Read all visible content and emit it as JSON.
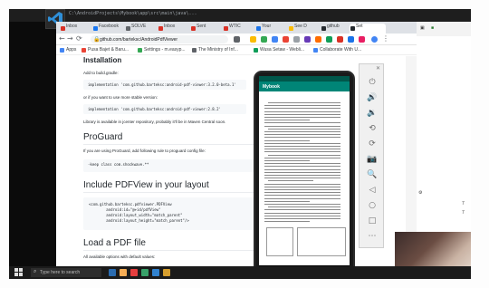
{
  "browser": {
    "tabs": [
      {
        "label": "Inbox",
        "color": "#d93025"
      },
      {
        "label": "Facebook",
        "color": "#1877f2"
      },
      {
        "label": "SOLVE",
        "color": "#5f6368"
      },
      {
        "label": "Inbox",
        "color": "#d93025"
      },
      {
        "label": "Sent",
        "color": "#d93025"
      },
      {
        "label": "WTIC",
        "color": "#d93025"
      },
      {
        "label": "Your",
        "color": "#1a73e8"
      },
      {
        "label": "See D",
        "color": "#fbbc04"
      },
      {
        "label": "github",
        "color": "#24292e"
      },
      {
        "label": "Set",
        "color": "#24292e"
      }
    ],
    "url": "github.com/barteksc/AndroidPdfViewer",
    "bookmarks": [
      {
        "label": "Apps",
        "color": "#4285f4"
      },
      {
        "label": "Pusa Bajet & Baru...",
        "color": "#ea4335"
      },
      {
        "label": "Settings - m.easyp...",
        "color": "#34a853"
      },
      {
        "label": "The Ministry of Inf...",
        "color": "#5f6368"
      },
      {
        "label": "Wusa Setaw - Webli...",
        "color": "#0f9d58"
      },
      {
        "label": "Collaborate With U...",
        "color": "#4285f4"
      }
    ]
  },
  "readme": {
    "installation_heading": "Installation",
    "add_gradle_text": "Add to build.gradle:",
    "impl_code": "implementation 'com.github.barteksc:android-pdf-viewer:3.2.0-beta.1'",
    "stable_text": "or if you want to use more stable version:",
    "impl_code_stable": "implementation 'com.github.barteksc:android-pdf-viewer:2.8.2'",
    "jcenter_text": "Library is available in jcenter repository, probably it'll be in Maven Central soon.",
    "proguard_heading": "ProGuard",
    "proguard_text": "If you are using ProGuard, add following rule to proguard config file:",
    "proguard_code": "-keep class com.shockwave.**",
    "layout_heading": "Include PDFView in your layout",
    "layout_code": "<com.github.barteksc.pdfviewer.PDFView\n        android:id=\"@+id/pdfView\"\n        android:layout_width=\"match_parent\"\n        android:layout_height=\"match_parent\"/>",
    "load_heading": "Load a PDF file",
    "load_text": "All available options with default values:"
  },
  "phone": {
    "app_title": "Mybook",
    "status_color": "#00574b",
    "appbar_color": "#008577",
    "nav": {
      "back": "◀",
      "home": "●",
      "recents": "■"
    }
  },
  "emulator_toolbar": {
    "close": "✕",
    "icons": [
      "power-icon",
      "volume-up-icon",
      "volume-down-icon",
      "rotate-left-icon",
      "rotate-right-icon",
      "camera-icon",
      "zoom-icon",
      "back-icon",
      "home-icon",
      "overview-icon",
      "more-icon"
    ],
    "glyphs": [
      "⏻",
      "🔊",
      "🔉",
      "⟲",
      "⟳",
      "📷",
      "🔍",
      "◁",
      "○",
      "□",
      "⋯"
    ]
  },
  "taskbar": {
    "search_placeholder": "Type here to search"
  }
}
